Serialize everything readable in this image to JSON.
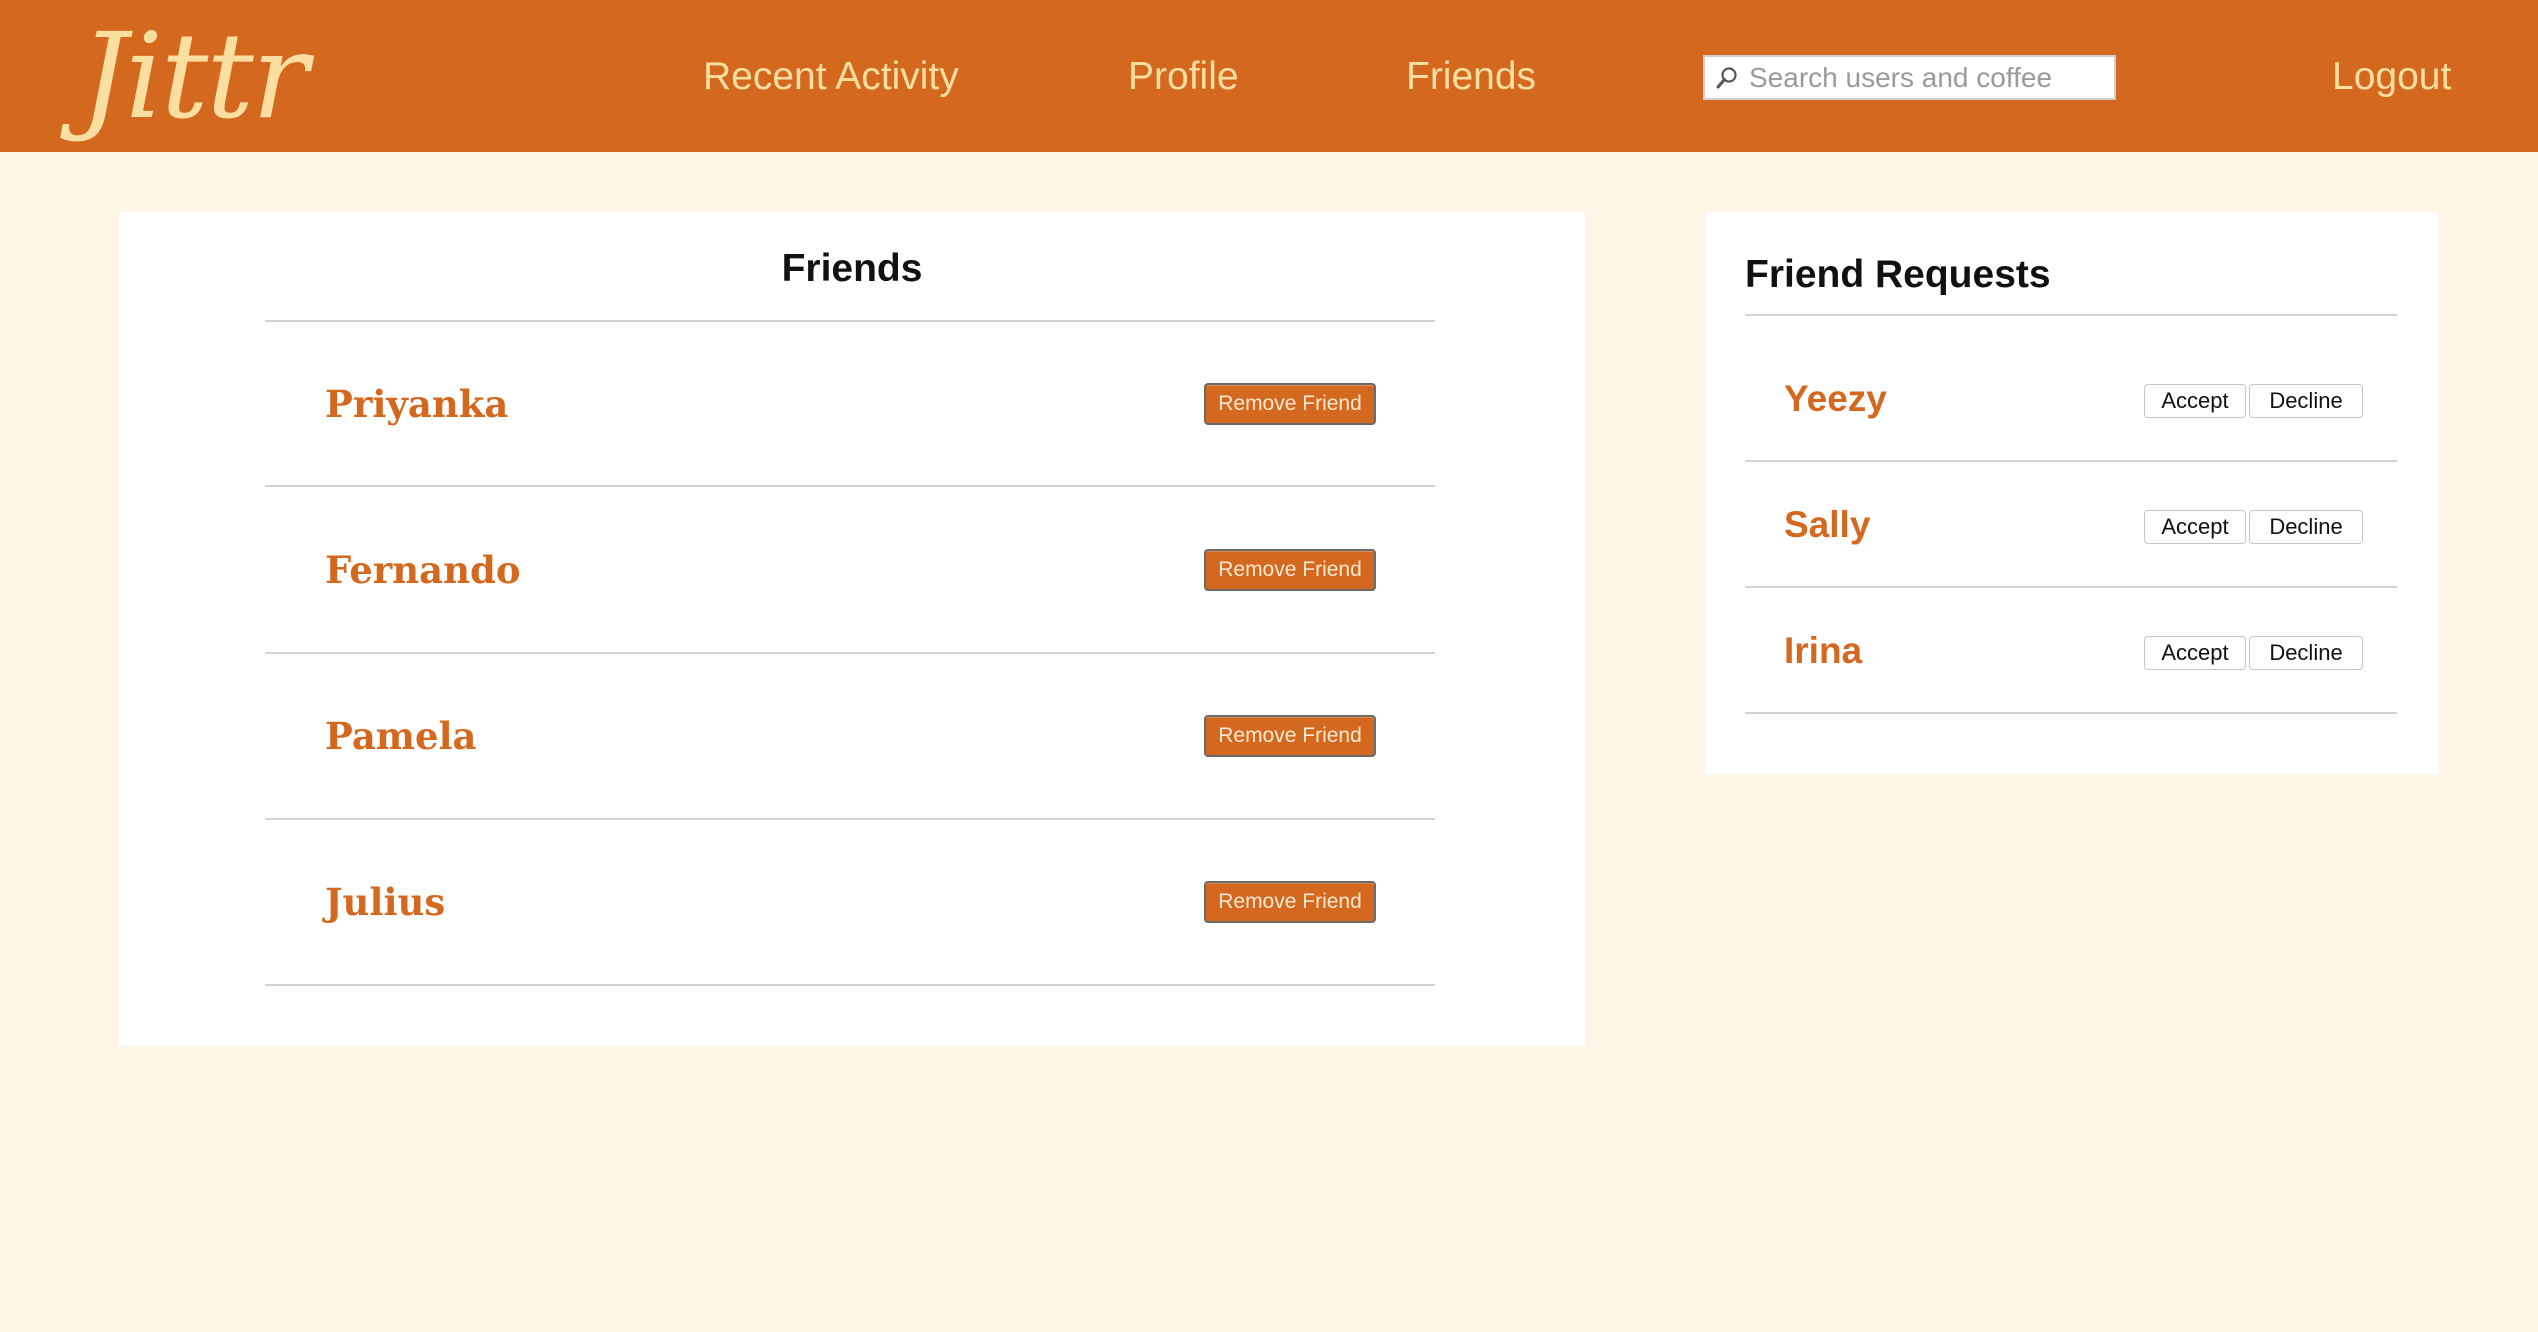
{
  "brand": {
    "logo_text": "Jittr",
    "accent_color": "#d4681f",
    "text_on_accent": "#fbdfa0",
    "page_background": "#fdf5e6"
  },
  "nav": {
    "links": [
      "Recent Activity",
      "Profile",
      "Friends"
    ],
    "search": {
      "placeholder": "Search users and coffee",
      "value": ""
    },
    "logout_label": "Logout"
  },
  "friends_panel": {
    "title": "Friends",
    "remove_label": "Remove Friend",
    "friends": [
      "Priyanka",
      "Fernando",
      "Pamela",
      "Julius"
    ]
  },
  "requests_panel": {
    "title": "Friend Requests",
    "accept_label": "Accept",
    "decline_label": "Decline",
    "requests": [
      "Yeezy",
      "Sally",
      "Irina"
    ]
  }
}
